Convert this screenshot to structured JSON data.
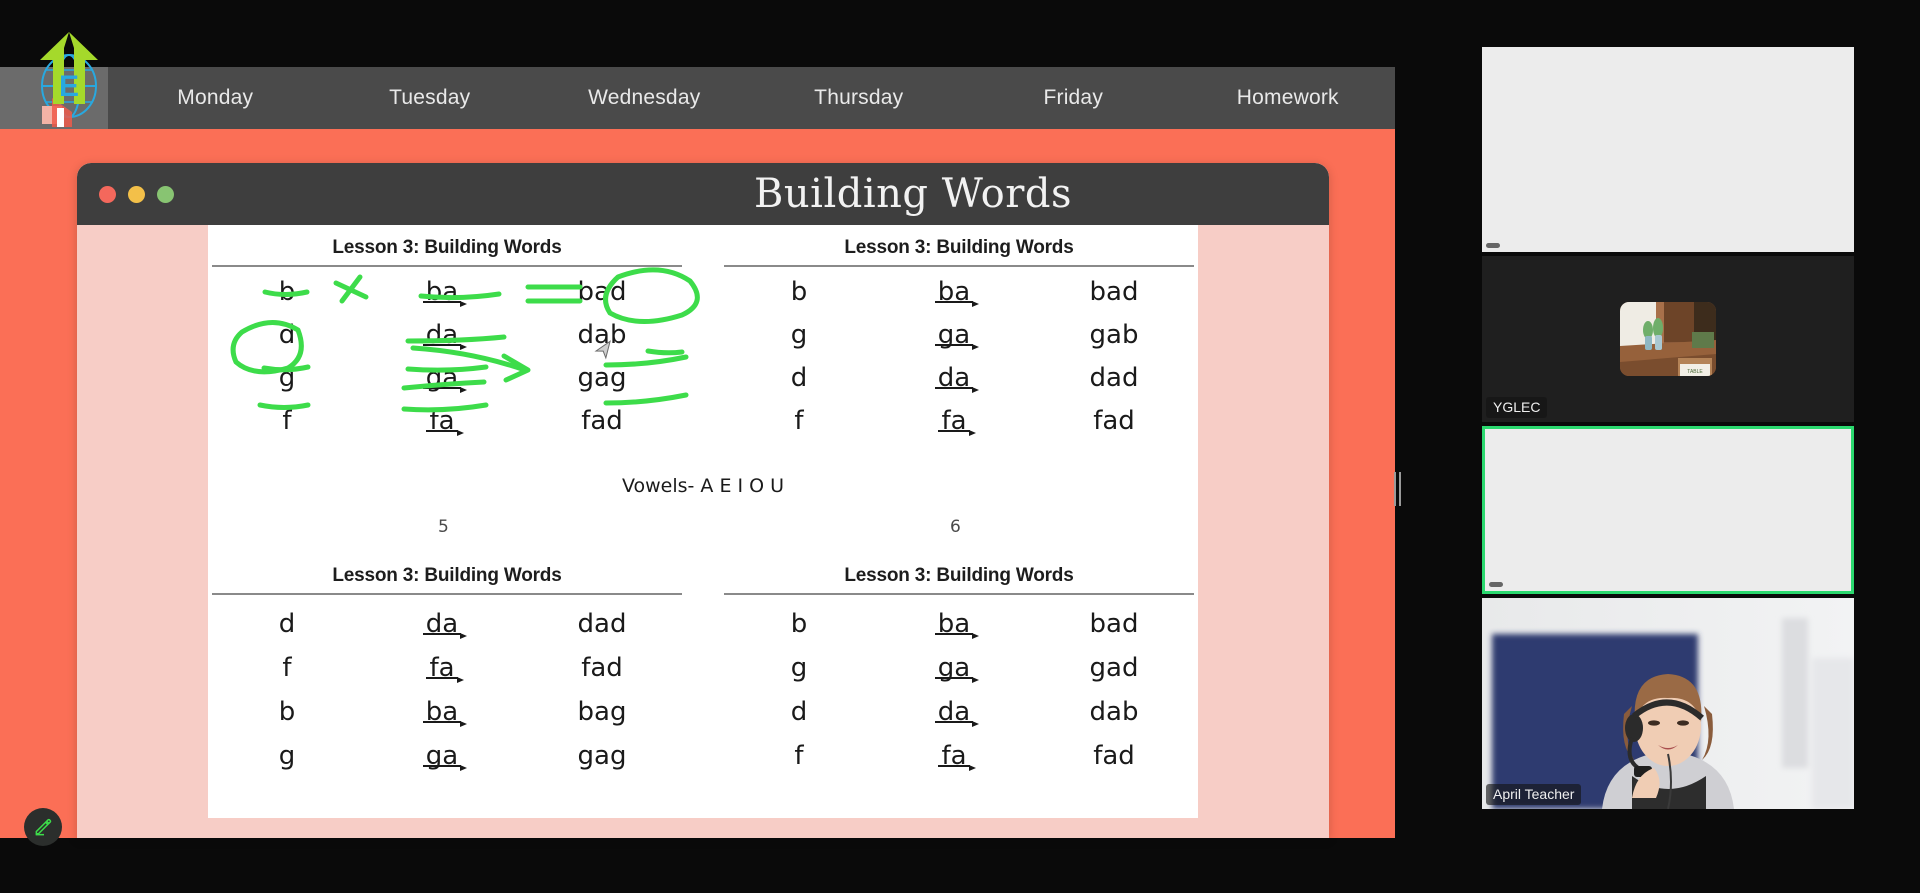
{
  "nav": {
    "tabs": [
      {
        "label": "Monday"
      },
      {
        "label": "Tuesday"
      },
      {
        "label": "Wednesday"
      },
      {
        "label": "Thursday"
      },
      {
        "label": "Friday"
      },
      {
        "label": "Homework"
      }
    ]
  },
  "logo": {
    "letter": "E",
    "alt": "education-globe-arrow-logo"
  },
  "slide": {
    "title": "Building Words",
    "window_dots": {
      "close": "#f4685c",
      "minimize": "#f3c049",
      "maximize": "#88c472"
    }
  },
  "worksheet": {
    "vowels_line": "Vowels- A E I O U",
    "blocks": [
      {
        "id": "block-5",
        "heading": "Lesson 3: Building Words",
        "page_number": "",
        "rows": [
          {
            "letter": "b",
            "blend": "ba",
            "word": "bad"
          },
          {
            "letter": "d",
            "blend": "da",
            "word": "dab"
          },
          {
            "letter": "g",
            "blend": "ga",
            "word": "gag"
          },
          {
            "letter": "f",
            "blend": "fa",
            "word": "fad"
          }
        ]
      },
      {
        "id": "block-6",
        "heading": "Lesson 3: Building Words",
        "page_number": "",
        "rows": [
          {
            "letter": "b",
            "blend": "ba",
            "word": "bad"
          },
          {
            "letter": "g",
            "blend": "ga",
            "word": "gab"
          },
          {
            "letter": "d",
            "blend": "da",
            "word": "dad"
          },
          {
            "letter": "f",
            "blend": "fa",
            "word": "fad"
          }
        ]
      },
      {
        "id": "block-7",
        "heading": "Lesson 3: Building Words",
        "page_number": "5",
        "rows": [
          {
            "letter": "d",
            "blend": "da",
            "word": "dad"
          },
          {
            "letter": "f",
            "blend": "fa",
            "word": "fad"
          },
          {
            "letter": "b",
            "blend": "ba",
            "word": "bag"
          },
          {
            "letter": "g",
            "blend": "ga",
            "word": "gag"
          }
        ]
      },
      {
        "id": "block-8",
        "heading": "Lesson 3: Building Words",
        "page_number": "6",
        "rows": [
          {
            "letter": "b",
            "blend": "ba",
            "word": "bad"
          },
          {
            "letter": "g",
            "blend": "ga",
            "word": "gad"
          },
          {
            "letter": "d",
            "blend": "da",
            "word": "dab"
          },
          {
            "letter": "f",
            "blend": "fa",
            "word": "fad"
          }
        ]
      }
    ],
    "annotation_color": "#3ddc4a"
  },
  "toolbar": {
    "annotate_icon": "pencil-icon"
  },
  "participants": [
    {
      "id": "tile-1",
      "name": "",
      "state": "blank-white"
    },
    {
      "id": "tile-2",
      "name": "YGLEC",
      "state": "avatar-photo"
    },
    {
      "id": "tile-3",
      "name": "",
      "state": "blank-white-active-speaker"
    },
    {
      "id": "tile-4",
      "name": "April Teacher",
      "state": "video-on"
    }
  ],
  "colors": {
    "coral": "#fb6f56",
    "nav_bar": "#4a4a4a",
    "titlebar": "#3e3e3e",
    "slide_mat": "#f7cdc6",
    "active_speaker": "#2bd96f",
    "ink_green": "#3ddc4a"
  }
}
